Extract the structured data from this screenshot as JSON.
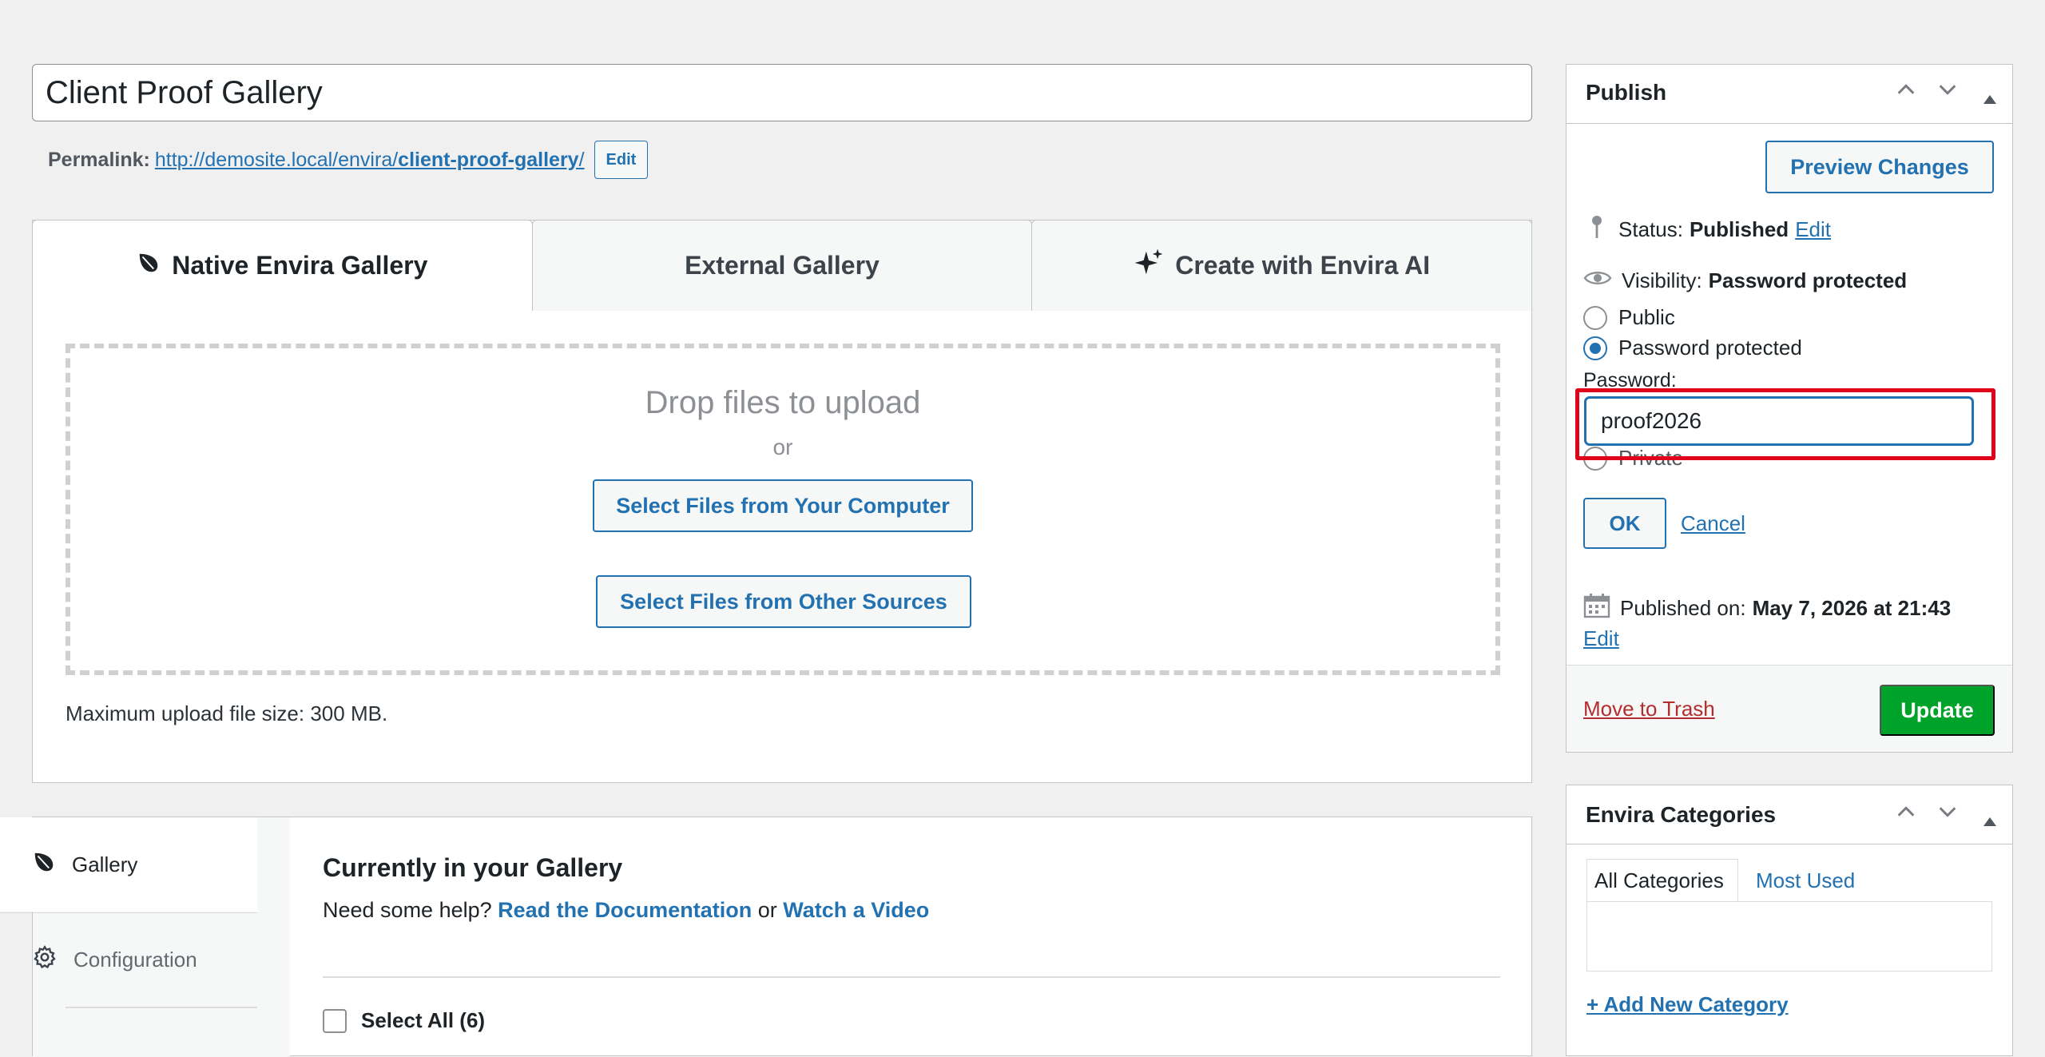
{
  "post": {
    "title": "Client Proof Gallery",
    "permalink_label": "Permalink:",
    "permalink_base": "http://demosite.local/envira/",
    "permalink_slug": "client-proof-gallery",
    "permalink_trail": "/",
    "permalink_edit": "Edit"
  },
  "tabs": [
    {
      "label": "Native Envira Gallery",
      "icon": "leaf-icon"
    },
    {
      "label": "External Gallery"
    },
    {
      "label": "Create with Envira AI",
      "icon": "sparkles-icon"
    }
  ],
  "uploader": {
    "drop_title": "Drop files to upload",
    "or": "or",
    "select_computer": "Select Files from Your Computer",
    "select_other": "Select Files from Other Sources",
    "max_size": "Maximum upload file size: 300 MB."
  },
  "gallery": {
    "nav": [
      {
        "label": "Gallery",
        "icon": "leaf-icon"
      },
      {
        "label": "Configuration",
        "icon": "gear-icon"
      }
    ],
    "title": "Currently in your Gallery",
    "help_prefix": "Need some help?",
    "help_doc": "Read the Documentation",
    "help_or": "or",
    "help_video": "Watch a Video",
    "select_all": "Select All (6)"
  },
  "publish": {
    "title": "Publish",
    "preview": "Preview Changes",
    "status_label": "Status:",
    "status_value": "Published",
    "status_edit": "Edit",
    "visibility_label": "Visibility:",
    "visibility_value": "Password protected",
    "options": [
      "Public",
      "Password protected",
      "Private"
    ],
    "selected_option": "Password protected",
    "password_label": "Password:",
    "password_value": "proof2026",
    "ok": "OK",
    "cancel": "Cancel",
    "published_label": "Published on:",
    "published_value": "May 7, 2026 at 21:43",
    "published_edit": "Edit",
    "trash": "Move to Trash",
    "update": "Update"
  },
  "categories": {
    "title": "Envira Categories",
    "tab_all": "All Categories",
    "tab_used": "Most Used",
    "add_new": "+ Add New Category"
  },
  "colors": {
    "accent": "#2271b1",
    "update_button": "#00a32a",
    "trash_link": "#b32d2e",
    "highlight_box": "#e0021a"
  }
}
